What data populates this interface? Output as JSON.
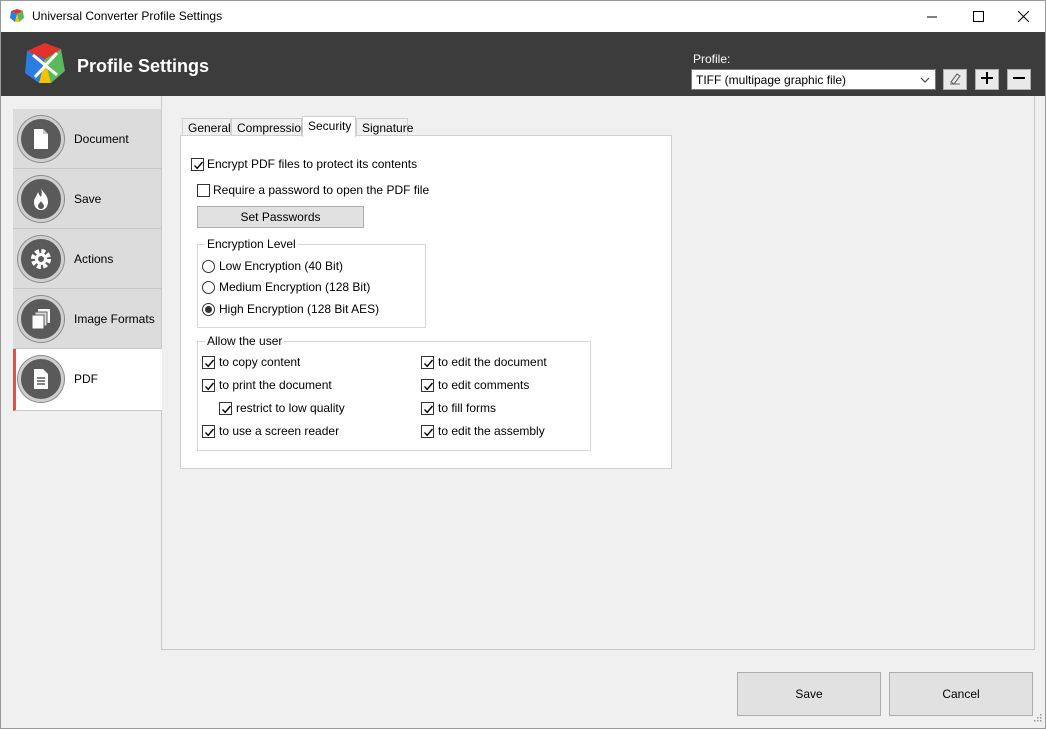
{
  "window": {
    "title": "Universal Converter Profile Settings"
  },
  "header": {
    "title": "Profile Settings",
    "profile_label": "Profile:",
    "profile_value": "TIFF (multipage graphic file)"
  },
  "nav": {
    "items": [
      {
        "label": "Document",
        "icon": "document-icon"
      },
      {
        "label": "Save",
        "icon": "flame-icon"
      },
      {
        "label": "Actions",
        "icon": "gear-icon"
      },
      {
        "label": "Image Formats",
        "icon": "stacked-pages-icon"
      },
      {
        "label": "PDF",
        "icon": "pdf-document-icon",
        "active": true
      }
    ]
  },
  "tabs": [
    {
      "label": "General"
    },
    {
      "label": "Compression"
    },
    {
      "label": "Security",
      "active": true
    },
    {
      "label": "Signature"
    }
  ],
  "security": {
    "encrypt_label": "Encrypt PDF files to protect its contents",
    "encrypt_checked": true,
    "require_password_label": "Require a password to open the PDF file",
    "require_password_checked": false,
    "set_passwords_label": "Set Passwords",
    "encryption_level": {
      "title": "Encryption Level",
      "options": [
        {
          "label": "Low Encryption (40 Bit)",
          "selected": false
        },
        {
          "label": "Medium Encryption (128 Bit)",
          "selected": false
        },
        {
          "label": "High Encryption (128 Bit AES)",
          "selected": true
        }
      ]
    },
    "allow_user": {
      "title": "Allow the user",
      "left": [
        {
          "label": "to copy content",
          "checked": true
        },
        {
          "label": "to print the document",
          "checked": true
        },
        {
          "label": "restrict to low quality",
          "checked": true
        },
        {
          "label": "to use a screen reader",
          "checked": true
        }
      ],
      "right": [
        {
          "label": "to edit the document",
          "checked": true
        },
        {
          "label": "to edit comments",
          "checked": true
        },
        {
          "label": "to fill forms",
          "checked": true
        },
        {
          "label": "to edit the assembly",
          "checked": true
        }
      ]
    }
  },
  "footer": {
    "save_label": "Save",
    "cancel_label": "Cancel"
  },
  "colors": {
    "header_bg": "#3c3c3c",
    "active_accent": "#d9534f"
  }
}
